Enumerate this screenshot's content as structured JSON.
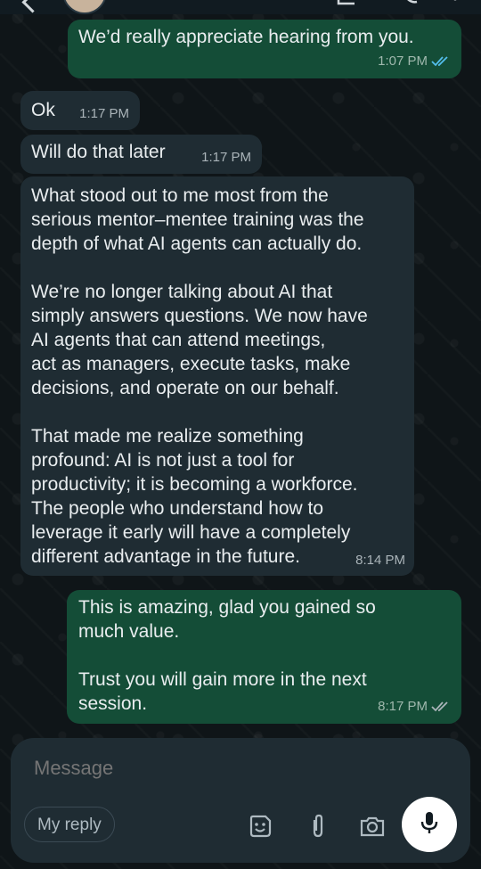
{
  "chat": {
    "messages": [
      {
        "direction": "out",
        "text": "We’d really appreciate hearing from you.",
        "time": "1:07 PM",
        "status": "read"
      },
      {
        "direction": "in",
        "text": "Ok",
        "time": "1:17 PM"
      },
      {
        "direction": "in",
        "text": "Will do that later",
        "time": "1:17 PM"
      },
      {
        "direction": "in",
        "text": "What stood out to me most from the\nserious mentor–mentee training was the\ndepth of what AI agents can actually do.\n\nWe’re no longer talking about AI that\nsimply answers questions. We now have\nAI agents that can attend meetings,\nact as managers, execute tasks, make\ndecisions, and operate on our behalf.\n\nThat made me realize something\nprofound: AI is not just a tool for\nproductivity; it is becoming a workforce.\nThe people who understand how to\nleverage it early will have a completely\ndifferent advantage in the future.",
        "time": "8:14 PM"
      },
      {
        "direction": "out",
        "text": "This is amazing, glad you gained so\nmuch value.\n\nTrust you will gain more in the next\nsession.",
        "time": "8:17 PM",
        "status": "delivered"
      }
    ]
  },
  "composer": {
    "placeholder": "Message",
    "quick_reply": "My reply",
    "icons": [
      "sticker-icon",
      "attachment-icon",
      "camera-icon",
      "mic-icon"
    ]
  },
  "colors": {
    "outgoing_bubble": "#144d37",
    "incoming_bubble": "#1f2c33",
    "read_tick": "#53bdeb",
    "background": "#0b141a"
  }
}
